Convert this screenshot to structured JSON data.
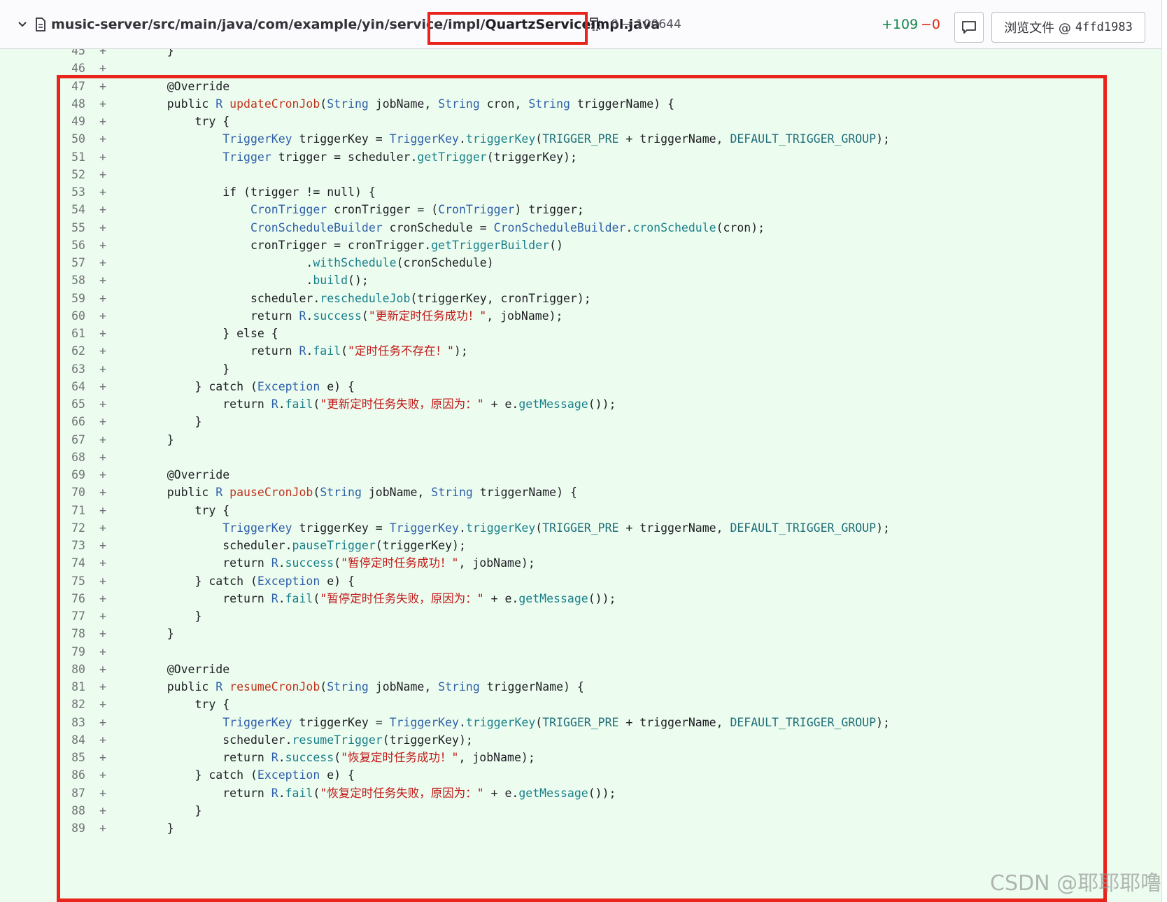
{
  "header": {
    "path": "music-server/src/main/java/com/example/yin/service/impl/",
    "filename": "QuartzServiceImpl.java",
    "mode_change": "0 → 100644",
    "additions": "+109",
    "deletions": "−0",
    "view_file_label": "浏览文件 @",
    "commit_hash": "4ffd1983"
  },
  "lines": [
    {
      "n": "45",
      "t": [
        [
          "    }"
        ]
      ]
    },
    {
      "n": "46",
      "t": []
    },
    {
      "n": "47",
      "t": [
        [
          "    @Override",
          "an"
        ]
      ]
    },
    {
      "n": "48",
      "t": [
        [
          "    public "
        ],
        [
          "R",
          "ty"
        ],
        [
          " "
        ],
        [
          "updateCronJob",
          "fn"
        ],
        [
          "("
        ],
        [
          "String",
          "ty"
        ],
        [
          " jobName, "
        ],
        [
          "String",
          "ty"
        ],
        [
          " cron, "
        ],
        [
          "String",
          "ty"
        ],
        [
          " triggerName) {"
        ]
      ]
    },
    {
      "n": "49",
      "t": [
        [
          "        try {"
        ]
      ]
    },
    {
      "n": "50",
      "t": [
        [
          "            "
        ],
        [
          "TriggerKey",
          "ty"
        ],
        [
          " triggerKey = "
        ],
        [
          "TriggerKey",
          "ty"
        ],
        [
          "."
        ],
        [
          "triggerKey",
          "mt"
        ],
        [
          "("
        ],
        [
          "TRIGGER_PRE",
          "cs"
        ],
        [
          " + triggerName, "
        ],
        [
          "DEFAULT_TRIGGER_GROUP",
          "cs"
        ],
        [
          ");"
        ]
      ]
    },
    {
      "n": "51",
      "t": [
        [
          "            "
        ],
        [
          "Trigger",
          "ty"
        ],
        [
          " trigger = scheduler."
        ],
        [
          "getTrigger",
          "mt"
        ],
        [
          "(triggerKey);"
        ]
      ]
    },
    {
      "n": "52",
      "t": []
    },
    {
      "n": "53",
      "t": [
        [
          "            if (trigger != null) {"
        ]
      ]
    },
    {
      "n": "54",
      "t": [
        [
          "                "
        ],
        [
          "CronTrigger",
          "ty"
        ],
        [
          " cronTrigger = ("
        ],
        [
          "CronTrigger",
          "ty"
        ],
        [
          ") trigger;"
        ]
      ]
    },
    {
      "n": "55",
      "t": [
        [
          "                "
        ],
        [
          "CronScheduleBuilder",
          "ty"
        ],
        [
          " cronSchedule = "
        ],
        [
          "CronScheduleBuilder",
          "ty"
        ],
        [
          "."
        ],
        [
          "cronSchedule",
          "mt"
        ],
        [
          "(cron);"
        ]
      ]
    },
    {
      "n": "56",
      "t": [
        [
          "                cronTrigger = cronTrigger."
        ],
        [
          "getTriggerBuilder",
          "mt"
        ],
        [
          "()"
        ]
      ]
    },
    {
      "n": "57",
      "t": [
        [
          "                        ."
        ],
        [
          "withSchedule",
          "mt"
        ],
        [
          "(cronSchedule)"
        ]
      ]
    },
    {
      "n": "58",
      "t": [
        [
          "                        ."
        ],
        [
          "build",
          "mt"
        ],
        [
          "();"
        ]
      ]
    },
    {
      "n": "59",
      "t": [
        [
          "                scheduler."
        ],
        [
          "rescheduleJob",
          "mt"
        ],
        [
          "(triggerKey, cronTrigger);"
        ]
      ]
    },
    {
      "n": "60",
      "t": [
        [
          "                return "
        ],
        [
          "R",
          "ty"
        ],
        [
          "."
        ],
        [
          "success",
          "mt"
        ],
        [
          "("
        ],
        [
          "\"更新定时任务成功！\"",
          "st"
        ],
        [
          ", jobName);"
        ]
      ]
    },
    {
      "n": "61",
      "t": [
        [
          "            } else {"
        ]
      ]
    },
    {
      "n": "62",
      "t": [
        [
          "                return "
        ],
        [
          "R",
          "ty"
        ],
        [
          "."
        ],
        [
          "fail",
          "mt"
        ],
        [
          "("
        ],
        [
          "\"定时任务不存在！\"",
          "st"
        ],
        [
          ");"
        ]
      ]
    },
    {
      "n": "63",
      "t": [
        [
          "            }"
        ]
      ]
    },
    {
      "n": "64",
      "t": [
        [
          "        } catch ("
        ],
        [
          "Exception",
          "ty"
        ],
        [
          " e) {"
        ]
      ]
    },
    {
      "n": "65",
      "t": [
        [
          "            return "
        ],
        [
          "R",
          "ty"
        ],
        [
          "."
        ],
        [
          "fail",
          "mt"
        ],
        [
          "("
        ],
        [
          "\"更新定时任务失败，原因为：\"",
          "st"
        ],
        [
          " + e."
        ],
        [
          "getMessage",
          "mt"
        ],
        [
          "());"
        ]
      ]
    },
    {
      "n": "66",
      "t": [
        [
          "        }"
        ]
      ]
    },
    {
      "n": "67",
      "t": [
        [
          "    }"
        ]
      ]
    },
    {
      "n": "68",
      "t": []
    },
    {
      "n": "69",
      "t": [
        [
          "    @Override",
          "an"
        ]
      ]
    },
    {
      "n": "70",
      "t": [
        [
          "    public "
        ],
        [
          "R",
          "ty"
        ],
        [
          " "
        ],
        [
          "pauseCronJob",
          "fn"
        ],
        [
          "("
        ],
        [
          "String",
          "ty"
        ],
        [
          " jobName, "
        ],
        [
          "String",
          "ty"
        ],
        [
          " triggerName) {"
        ]
      ]
    },
    {
      "n": "71",
      "t": [
        [
          "        try {"
        ]
      ]
    },
    {
      "n": "72",
      "t": [
        [
          "            "
        ],
        [
          "TriggerKey",
          "ty"
        ],
        [
          " triggerKey = "
        ],
        [
          "TriggerKey",
          "ty"
        ],
        [
          "."
        ],
        [
          "triggerKey",
          "mt"
        ],
        [
          "("
        ],
        [
          "TRIGGER_PRE",
          "cs"
        ],
        [
          " + triggerName, "
        ],
        [
          "DEFAULT_TRIGGER_GROUP",
          "cs"
        ],
        [
          ");"
        ]
      ]
    },
    {
      "n": "73",
      "t": [
        [
          "            scheduler."
        ],
        [
          "pauseTrigger",
          "mt"
        ],
        [
          "(triggerKey);"
        ]
      ]
    },
    {
      "n": "74",
      "t": [
        [
          "            return "
        ],
        [
          "R",
          "ty"
        ],
        [
          "."
        ],
        [
          "success",
          "mt"
        ],
        [
          "("
        ],
        [
          "\"暂停定时任务成功！\"",
          "st"
        ],
        [
          ", jobName);"
        ]
      ]
    },
    {
      "n": "75",
      "t": [
        [
          "        } catch ("
        ],
        [
          "Exception",
          "ty"
        ],
        [
          " e) {"
        ]
      ]
    },
    {
      "n": "76",
      "t": [
        [
          "            return "
        ],
        [
          "R",
          "ty"
        ],
        [
          "."
        ],
        [
          "fail",
          "mt"
        ],
        [
          "("
        ],
        [
          "\"暂停定时任务失败，原因为：\"",
          "st"
        ],
        [
          " + e."
        ],
        [
          "getMessage",
          "mt"
        ],
        [
          "());"
        ]
      ]
    },
    {
      "n": "77",
      "t": [
        [
          "        }"
        ]
      ]
    },
    {
      "n": "78",
      "t": [
        [
          "    }"
        ]
      ]
    },
    {
      "n": "79",
      "t": []
    },
    {
      "n": "80",
      "t": [
        [
          "    @Override",
          "an"
        ]
      ]
    },
    {
      "n": "81",
      "t": [
        [
          "    public "
        ],
        [
          "R",
          "ty"
        ],
        [
          " "
        ],
        [
          "resumeCronJob",
          "fn"
        ],
        [
          "("
        ],
        [
          "String",
          "ty"
        ],
        [
          " jobName, "
        ],
        [
          "String",
          "ty"
        ],
        [
          " triggerName) {"
        ]
      ]
    },
    {
      "n": "82",
      "t": [
        [
          "        try {"
        ]
      ]
    },
    {
      "n": "83",
      "t": [
        [
          "            "
        ],
        [
          "TriggerKey",
          "ty"
        ],
        [
          " triggerKey = "
        ],
        [
          "TriggerKey",
          "ty"
        ],
        [
          "."
        ],
        [
          "triggerKey",
          "mt"
        ],
        [
          "("
        ],
        [
          "TRIGGER_PRE",
          "cs"
        ],
        [
          " + triggerName, "
        ],
        [
          "DEFAULT_TRIGGER_GROUP",
          "cs"
        ],
        [
          ");"
        ]
      ]
    },
    {
      "n": "84",
      "t": [
        [
          "            scheduler."
        ],
        [
          "resumeTrigger",
          "mt"
        ],
        [
          "(triggerKey);"
        ]
      ]
    },
    {
      "n": "85",
      "t": [
        [
          "            return "
        ],
        [
          "R",
          "ty"
        ],
        [
          "."
        ],
        [
          "success",
          "mt"
        ],
        [
          "("
        ],
        [
          "\"恢复定时任务成功！\"",
          "st"
        ],
        [
          ", jobName);"
        ]
      ]
    },
    {
      "n": "86",
      "t": [
        [
          "        } catch ("
        ],
        [
          "Exception",
          "ty"
        ],
        [
          " e) {"
        ]
      ]
    },
    {
      "n": "87",
      "t": [
        [
          "            return "
        ],
        [
          "R",
          "ty"
        ],
        [
          "."
        ],
        [
          "fail",
          "mt"
        ],
        [
          "("
        ],
        [
          "\"恢复定时任务失败，原因为：\"",
          "st"
        ],
        [
          " + e."
        ],
        [
          "getMessage",
          "mt"
        ],
        [
          "());"
        ]
      ]
    },
    {
      "n": "88",
      "t": [
        [
          "        }"
        ]
      ]
    },
    {
      "n": "89",
      "t": [
        [
          "    }"
        ]
      ]
    }
  ],
  "plus_marker": "+",
  "watermark": "CSDN @耶耶耶噜",
  "colors": {
    "added_bg": "#ecfdf0",
    "highlight_border": "#e8241c",
    "additions": "#108548",
    "deletions": "#dd2b0e"
  }
}
